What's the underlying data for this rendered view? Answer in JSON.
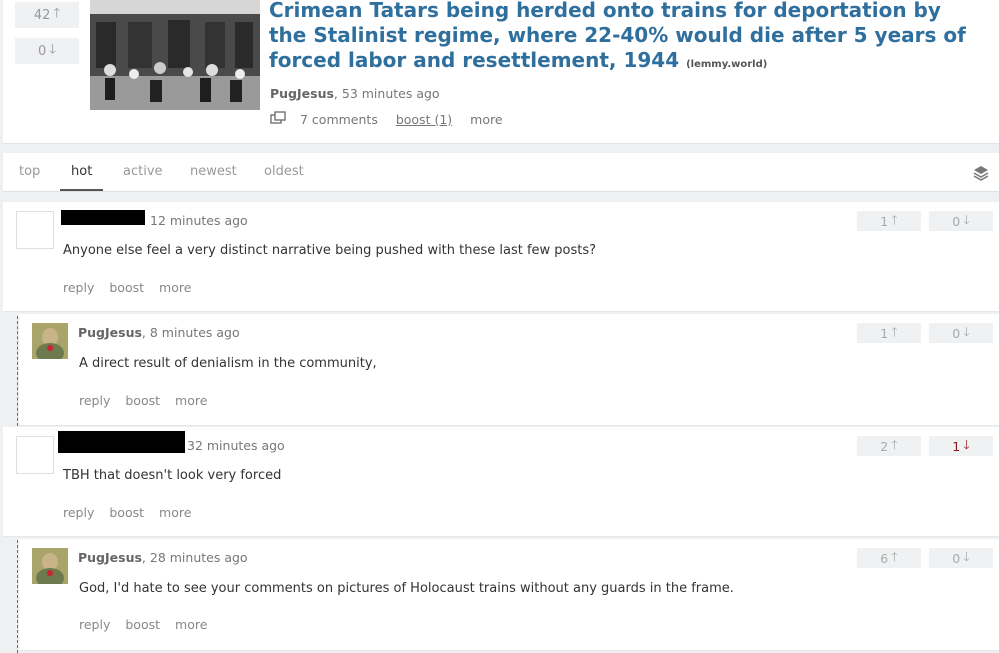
{
  "post": {
    "upvotes": "42",
    "downvotes": "0",
    "title": "Crimean Tatars being herded onto trains for deportation by the Stalinist regime, where 22-40% would die after 5 years of forced labor and resettlement, 1944",
    "domain": "(lemmy.world)",
    "author": "PugJesus",
    "time": ", 53 minutes ago",
    "comments_label": "7 comments",
    "boost_label": "boost (1)",
    "more_label": "more"
  },
  "tabs": [
    "top",
    "hot",
    "active",
    "newest",
    "oldest"
  ],
  "active_tab": "hot",
  "comments": [
    {
      "author": "",
      "time": "12 minutes ago",
      "body": "Anyone else feel a very distinct narrative being pushed with these last few posts?",
      "up": "1",
      "down": "0",
      "actions": [
        "reply",
        "boost",
        "more"
      ]
    },
    {
      "author": "PugJesus",
      "time": ", 8 minutes ago",
      "body": "A direct result of denialism in the community,",
      "up": "1",
      "down": "0",
      "actions": [
        "reply",
        "boost",
        "more"
      ]
    },
    {
      "author": "",
      "time": "32 minutes ago",
      "body": "TBH that doesn't look very forced",
      "up": "2",
      "down": "1",
      "actions": [
        "reply",
        "boost",
        "more"
      ]
    },
    {
      "author": "PugJesus",
      "time": ", 28 minutes ago",
      "body": "God, I'd hate to see your comments on pictures of Holocaust trains without any guards in the frame.",
      "up": "6",
      "down": "0",
      "actions": [
        "reply",
        "boost",
        "more"
      ]
    }
  ],
  "icons": {
    "up": "arrow-up-icon",
    "down": "arrow-down-icon",
    "crosspost": "crosspost-icon",
    "layers": "layers-icon"
  },
  "colors": {
    "title": "#2f6f9e",
    "downvote_active": "#8b1a1a",
    "thread_line": "#2e8b57"
  }
}
